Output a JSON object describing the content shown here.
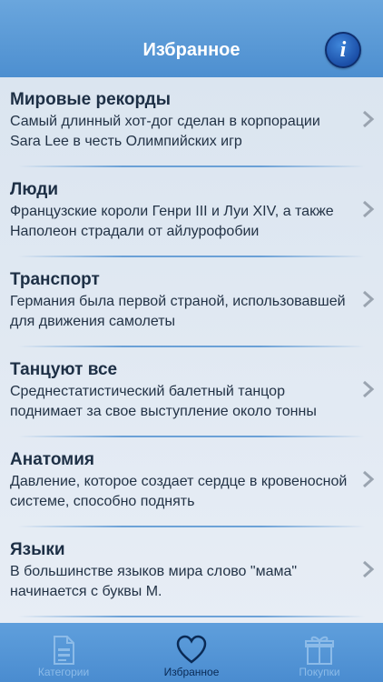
{
  "header": {
    "title": "Избранное"
  },
  "items": [
    {
      "category": "Мировые рекорды",
      "fact": "Самый длинный хот-дог сделан в корпорации Sara Lee в честь Олимпийских игр"
    },
    {
      "category": "Люди",
      "fact": "Французские короли Генри III и Луи XIV, а также Наполеон страдали от айлурофобии"
    },
    {
      "category": "Транспорт",
      "fact": "Германия была первой страной, использовавшей для движения самолеты"
    },
    {
      "category": "Танцуют все",
      "fact": "Среднестатистический балетный танцор поднимает за свое выступление около тонны"
    },
    {
      "category": "Анатомия",
      "fact": "Давление, которое создает сердце в кровеносной системе, способно поднять"
    },
    {
      "category": "Языки",
      "fact": "В большинстве языков мира слово \"мама\" начинается с буквы М."
    }
  ],
  "tabbar": {
    "categories": "Категории",
    "favorites": "Избранное",
    "purchases": "Покупки"
  },
  "icons": {
    "info": "i"
  },
  "colors": {
    "accent": "#4d8fd0",
    "active_tab": "#0a2a55",
    "background": "#dde6f1"
  }
}
